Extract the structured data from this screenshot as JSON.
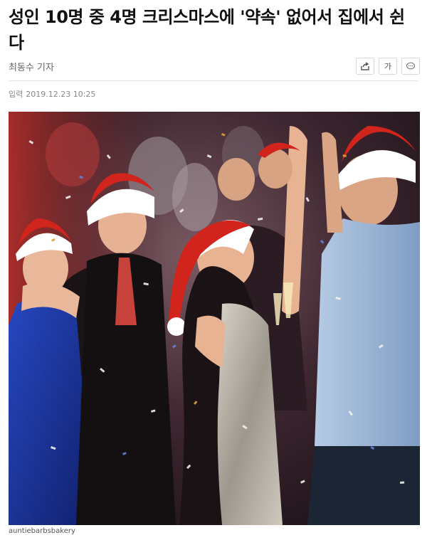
{
  "article": {
    "headline": "성인 10명 중 4명 크리스마스에 '약속' 없어서 집에서 쉰다",
    "byline": "최동수 기자",
    "date_label": "입력",
    "date_value": "2019.12.23 10:25",
    "image_caption": "auntiebarbsbakery"
  },
  "toolbar": {
    "share_icon": "share-icon",
    "font_size_label": "가",
    "comment_icon": "comment-icon"
  },
  "colors": {
    "headline": "#111111",
    "meta": "#888888",
    "santa_red": "#d0241c",
    "dress_silver": "#b9b3aa",
    "dress_blue": "#1a3aa8",
    "shirt_blue": "#9fb9d8"
  }
}
